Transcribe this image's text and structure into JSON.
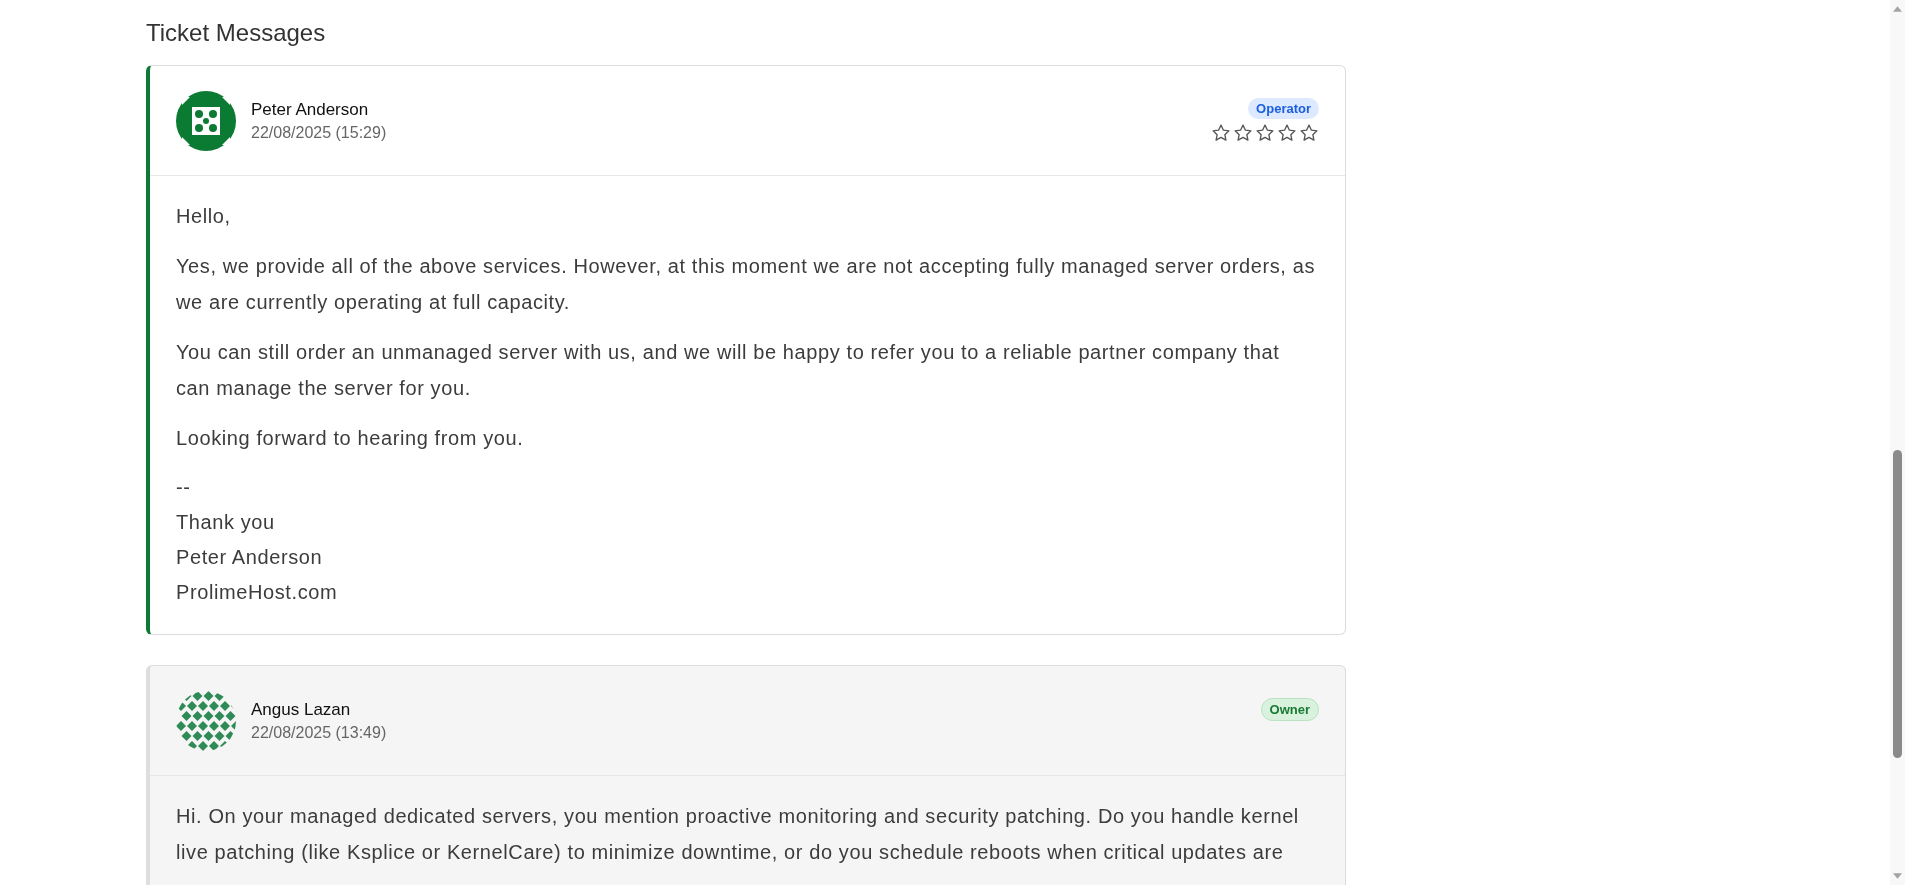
{
  "section_title": "Ticket Messages",
  "messages": [
    {
      "author": "Peter Anderson",
      "timestamp": "22/08/2025 (15:29)",
      "role": {
        "kind": "operator",
        "label": "Operator"
      },
      "stars": 0,
      "body": [
        {
          "kind": "paragraph",
          "lines": [
            "Hello,"
          ]
        },
        {
          "kind": "paragraph",
          "lines": [
            "Yes, we provide all of the above services. However, at this moment we are not accepting fully managed server orders, as we are currently operating at full capacity."
          ]
        },
        {
          "kind": "paragraph",
          "lines": [
            "You can still order an unmanaged server with us, and we will be happy to refer you to a reliable partner company that can manage the server for you."
          ]
        },
        {
          "kind": "paragraph",
          "lines": [
            "Looking forward to hearing from you."
          ]
        },
        {
          "kind": "signature",
          "lines": [
            "--",
            "Thank you",
            "Peter Anderson",
            "ProlimeHost.com"
          ]
        }
      ]
    },
    {
      "author": "Angus Lazan",
      "timestamp": "22/08/2025 (13:49)",
      "role": {
        "kind": "owner",
        "label": "Owner"
      },
      "body": [
        {
          "kind": "paragraph",
          "lines": [
            "Hi. On your managed dedicated servers, you mention proactive monitoring and security patching. Do you handle kernel live patching (like Ksplice or KernelCare) to minimize downtime, or do you schedule reboots when critical updates are"
          ]
        }
      ]
    }
  ]
}
